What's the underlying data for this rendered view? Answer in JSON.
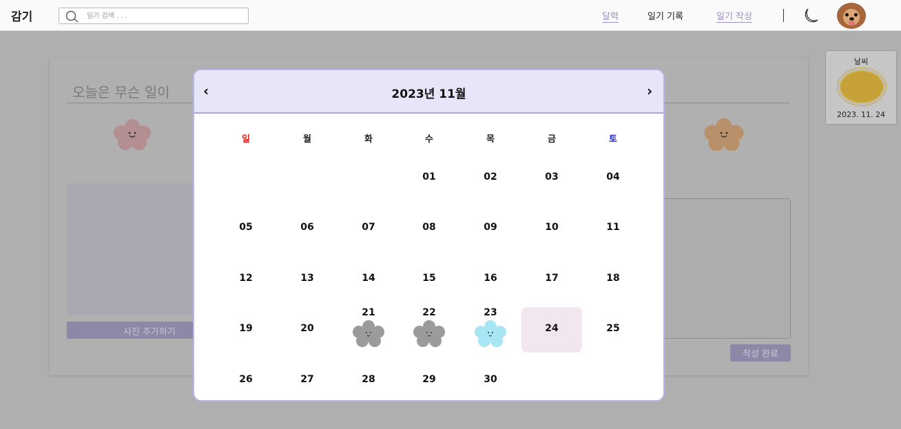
{
  "header": {
    "logo": "감기",
    "search_placeholder": "일기 검색 . . .",
    "nav": {
      "calendar": "달력",
      "records": "일기 기록",
      "write": "일기 작성"
    }
  },
  "editor": {
    "title_placeholder": "오늘은 무슨 일이",
    "photo_button": "사진 추가하기",
    "submit_button": "작성 완료"
  },
  "weather": {
    "label": "날씨",
    "date": "2023. 11. 24"
  },
  "calendar": {
    "title": "2023년 11월",
    "prev": "‹",
    "next": "›",
    "weekdays": [
      "일",
      "월",
      "화",
      "수",
      "목",
      "금",
      "토"
    ],
    "first_weekday_index": 3,
    "days": [
      "01",
      "02",
      "03",
      "04",
      "05",
      "06",
      "07",
      "08",
      "09",
      "10",
      "11",
      "12",
      "13",
      "14",
      "15",
      "16",
      "17",
      "18",
      "19",
      "20",
      "21",
      "22",
      "23",
      "24",
      "25",
      "26",
      "27",
      "28",
      "29",
      "30"
    ],
    "today": "24",
    "entries": [
      {
        "day": "21",
        "mood": "gray-flower-icon",
        "color": "#9b9b9b"
      },
      {
        "day": "22",
        "mood": "gray-flower-icon",
        "color": "#9b9b9b"
      },
      {
        "day": "23",
        "mood": "blue-flower-icon",
        "color": "#a9e6f3"
      }
    ]
  },
  "colors": {
    "accent": "#9c8fc7",
    "modal_border": "#b9b3e8",
    "modal_header": "#e6e6f8",
    "today_bg": "#f2e6ef",
    "sunday": "#e0201c",
    "saturday": "#1d1dd0"
  }
}
